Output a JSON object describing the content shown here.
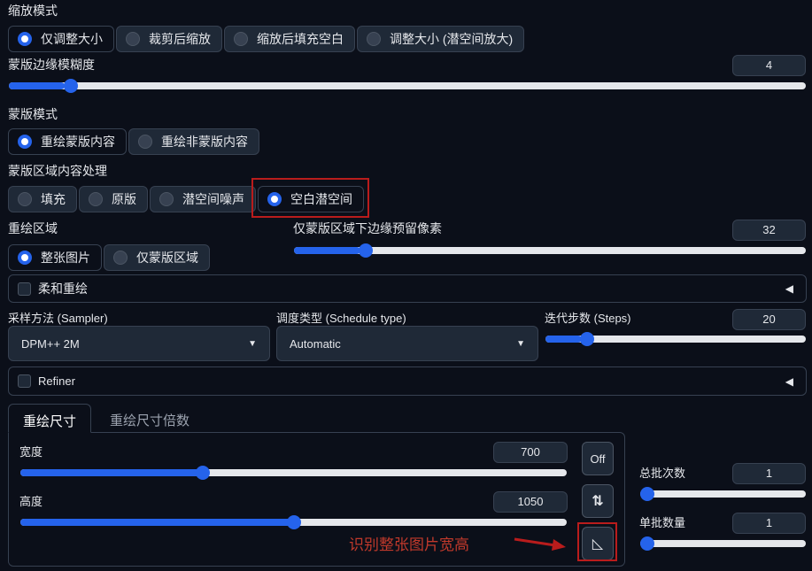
{
  "resize_mode": {
    "label": "缩放模式",
    "options": [
      "仅调整大小",
      "裁剪后缩放",
      "缩放后填充空白",
      "调整大小 (潜空间放大)"
    ],
    "selected": 0
  },
  "mask_blur": {
    "label": "蒙版边缘模糊度",
    "value": "4",
    "fraction": 0.07
  },
  "mask_mode": {
    "label": "蒙版模式",
    "options": [
      "重绘蒙版内容",
      "重绘非蒙版内容"
    ],
    "selected": 0
  },
  "masked_content": {
    "label": "蒙版区域内容处理",
    "options": [
      "填充",
      "原版",
      "潜空间噪声",
      "空白潜空间"
    ],
    "selected": 3
  },
  "inpaint_area": {
    "label": "重绘区域",
    "options": [
      "整张图片",
      "仅蒙版区域"
    ],
    "selected": 0
  },
  "padding": {
    "label": "仅蒙版区域下边缘预留像素",
    "value": "32",
    "fraction": 0.13
  },
  "soft_inpaint": {
    "label": "柔和重绘",
    "arrow": "◀"
  },
  "sampler": {
    "label": "采样方法 (Sampler)",
    "value": "DPM++ 2M"
  },
  "schedule": {
    "label": "调度类型 (Schedule type)",
    "value": "Automatic"
  },
  "steps": {
    "label": "迭代步数 (Steps)",
    "value": "20",
    "fraction": 0.14
  },
  "refiner": {
    "label": "Refiner",
    "arrow": "◀"
  },
  "size_tabs": [
    "重绘尺寸",
    "重绘尺寸倍数"
  ],
  "width": {
    "label": "宽度",
    "value": "700",
    "fraction": 0.33
  },
  "height": {
    "label": "高度",
    "value": "1050",
    "fraction": 0.5
  },
  "buttons": {
    "off": "Off",
    "swap": "⇅",
    "detect": "◺"
  },
  "batch_count": {
    "label": "总批次数",
    "value": "1",
    "fraction": 0.0
  },
  "batch_size": {
    "label": "单批数量",
    "value": "1",
    "fraction": 0.0
  },
  "annotation": {
    "text": "识别整张图片宽高",
    "color": "#c0392b"
  },
  "colors": {
    "accent": "#2563eb",
    "annotation_red": "#b91c1c"
  }
}
